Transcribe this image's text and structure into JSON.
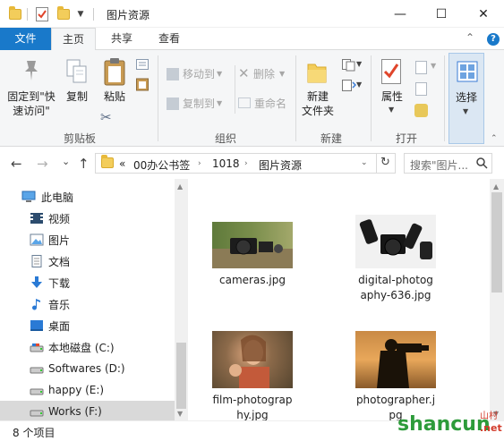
{
  "window": {
    "title": "图片资源",
    "minimize": "—",
    "maximize": "☐",
    "close": "✕"
  },
  "tabs": {
    "file": "文件",
    "home": "主页",
    "share": "共享",
    "view": "查看",
    "collapse": "⌃",
    "help": "?"
  },
  "ribbon": {
    "pin_label": "固定到\"快\n速访问\"",
    "copy_label": "复制",
    "paste_label": "粘贴",
    "clipboard_group": "剪贴板",
    "move_to": "移动到",
    "copy_to": "复制到",
    "delete": "删除",
    "rename": "重命名",
    "organize_group": "组织",
    "new_folder": "新建\n文件夹",
    "new_group": "新建",
    "properties": "属性",
    "open_group": "打开",
    "select": "选择"
  },
  "address": {
    "back": "←",
    "forward": "→",
    "recent": "⌄",
    "up": "↑",
    "overflow": "«",
    "crumbs": [
      "00办公书签",
      "1018",
      "图片资源"
    ],
    "refresh": "↻",
    "search_placeholder": "搜索\"图片...",
    "search_icon": "search-icon"
  },
  "nav": {
    "items": [
      {
        "label": "此电脑",
        "icon": "computer-icon"
      },
      {
        "label": "视频",
        "icon": "video-icon"
      },
      {
        "label": "图片",
        "icon": "pictures-icon"
      },
      {
        "label": "文档",
        "icon": "documents-icon"
      },
      {
        "label": "下载",
        "icon": "download-icon"
      },
      {
        "label": "音乐",
        "icon": "music-icon"
      },
      {
        "label": "桌面",
        "icon": "desktop-icon"
      },
      {
        "label": "本地磁盘 (C:)",
        "icon": "drive-icon"
      },
      {
        "label": "Softwares (D:)",
        "icon": "drive-icon"
      },
      {
        "label": "happy (E:)",
        "icon": "drive-icon"
      },
      {
        "label": "Works (F:)",
        "icon": "drive-icon"
      }
    ]
  },
  "files": [
    {
      "name": "cameras.jpg"
    },
    {
      "name": "digital-photog\naphy-636.jpg"
    },
    {
      "name": "film-photograp\nhy.jpg"
    },
    {
      "name": "photographer.j\npg"
    }
  ],
  "status": {
    "count": "8 个项目"
  },
  "watermark": {
    "text": "shancun",
    "suffix": ".net",
    "cn": "山村"
  },
  "colors": {
    "accent": "#1979ca",
    "ribbon_bg": "#f5f6f7",
    "selected": "#d9d9d9"
  }
}
